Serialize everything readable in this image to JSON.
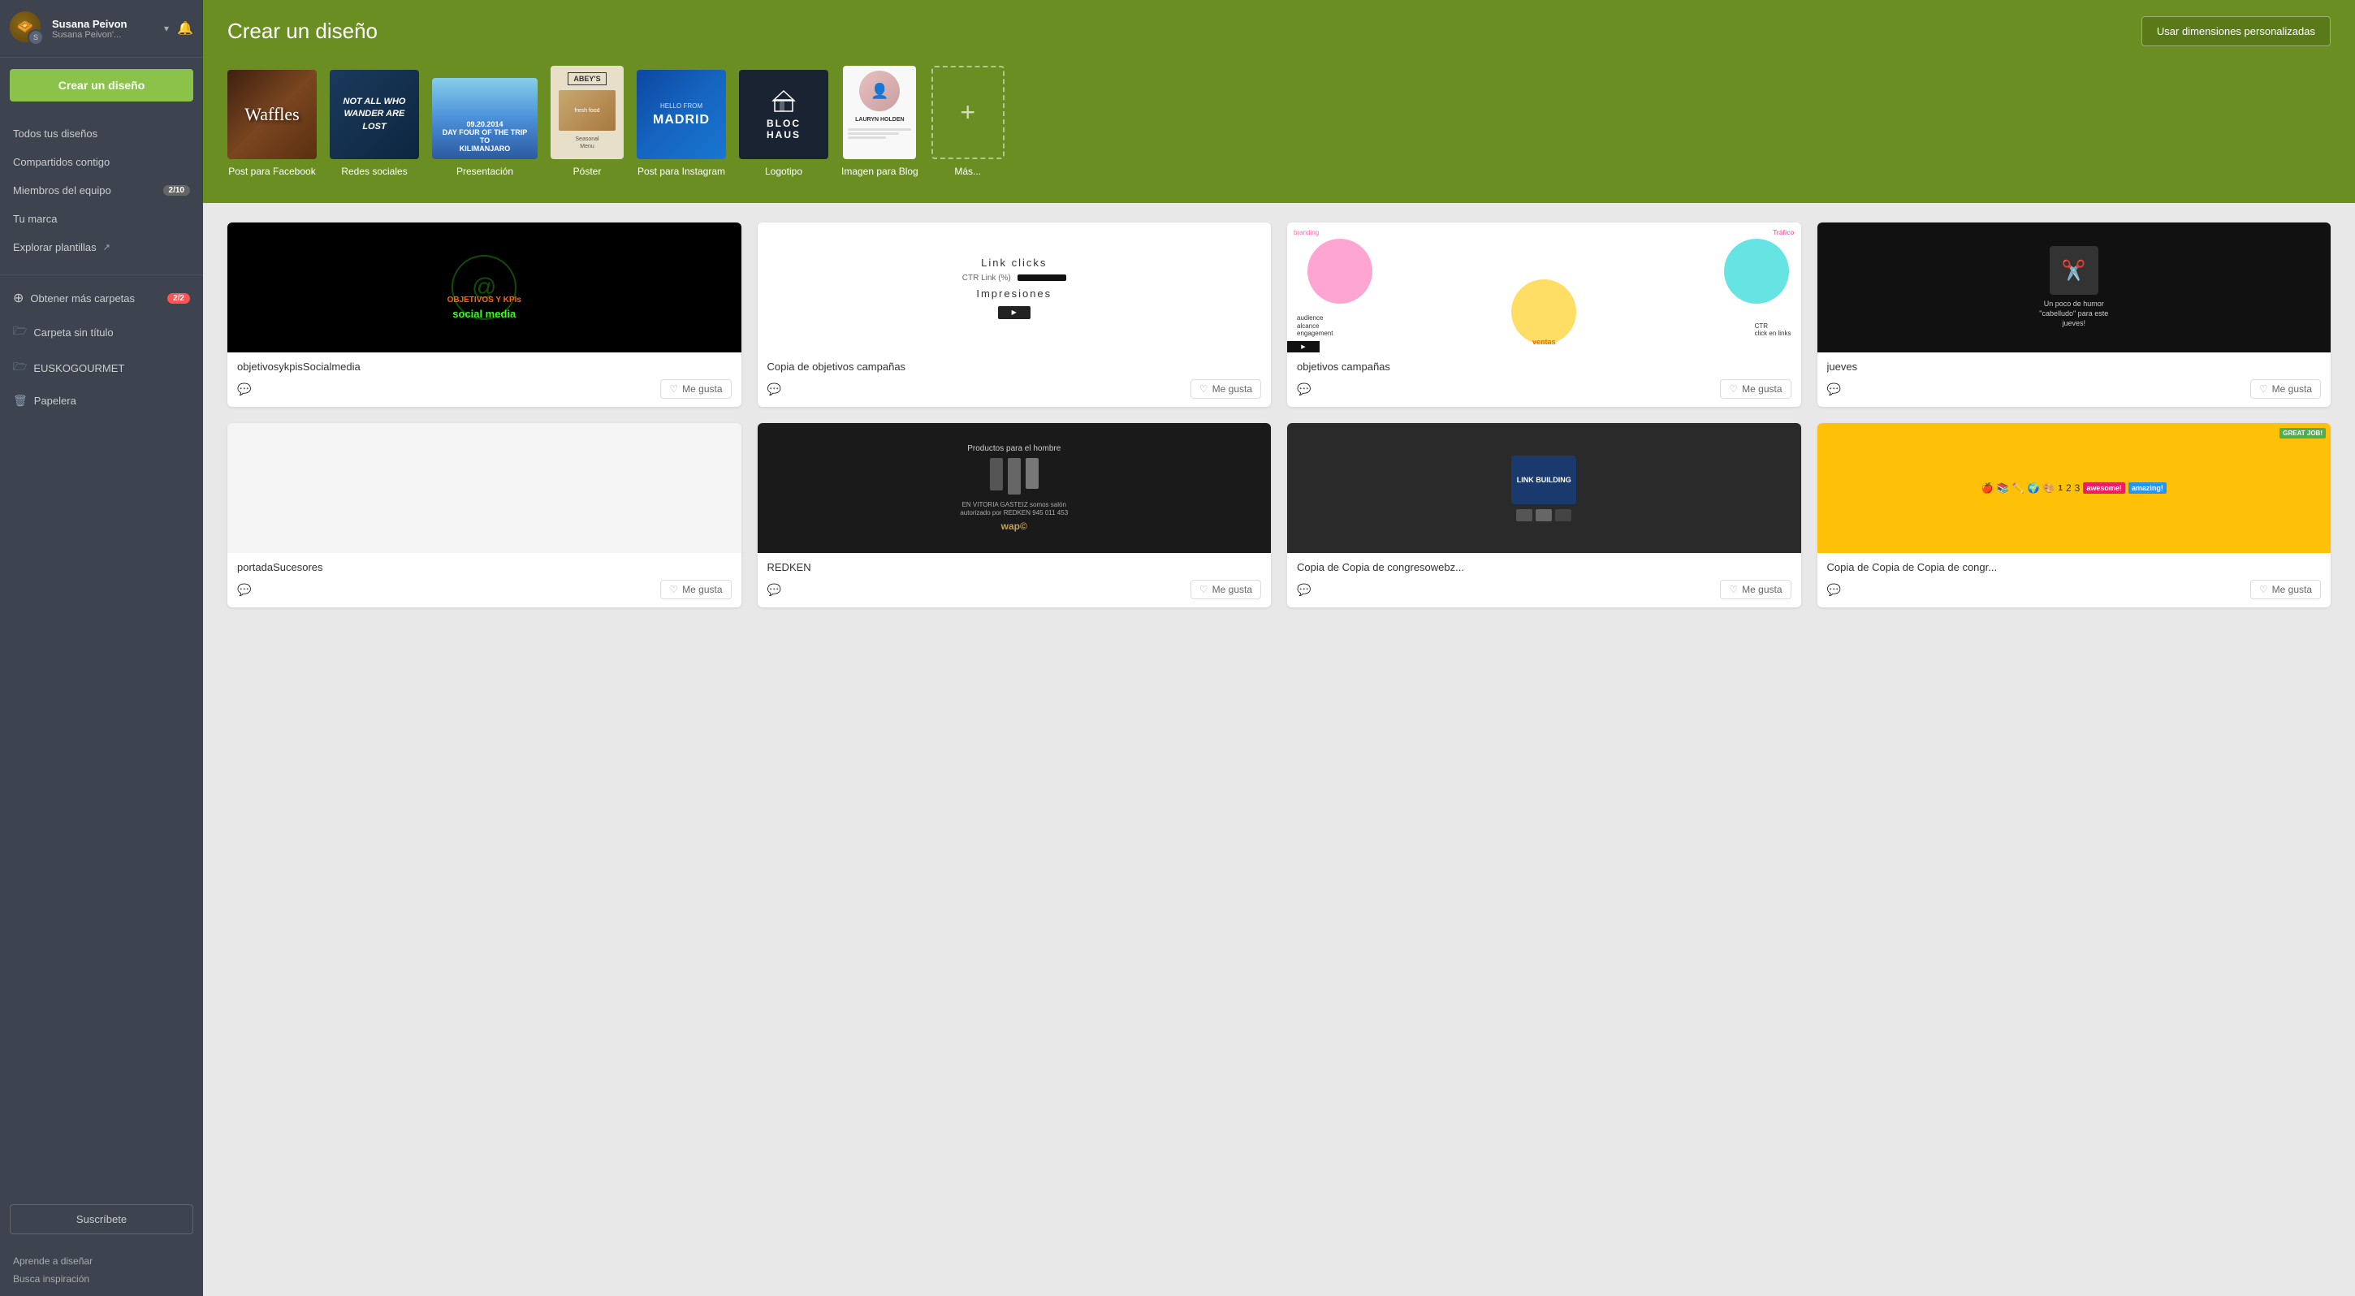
{
  "sidebar": {
    "user": {
      "name": "Susana Peivon",
      "sub": "Susana Peivon'...",
      "initials": "S"
    },
    "create_btn": "Crear un diseño",
    "nav_items": [
      {
        "id": "all-designs",
        "label": "Todos tus diseños",
        "icon": ""
      },
      {
        "id": "shared",
        "label": "Compartidos contigo",
        "icon": ""
      },
      {
        "id": "team",
        "label": "Miembros del equipo",
        "icon": "",
        "badge": "2/10"
      },
      {
        "id": "brand",
        "label": "Tu marca",
        "icon": ""
      },
      {
        "id": "explore",
        "label": "Explorar plantillas",
        "icon": "↗"
      }
    ],
    "folders_label": "Obtener más carpetas",
    "folders_badge": "2/2",
    "folders": [
      {
        "id": "untitled",
        "label": "Carpeta sin título",
        "icon": "folder"
      },
      {
        "id": "euskogourmet",
        "label": "EUSKOGOURMET",
        "icon": "folder"
      },
      {
        "id": "trash",
        "label": "Papelera",
        "icon": "trash"
      }
    ],
    "subscribe_btn": "Suscríbete",
    "footer_links": [
      {
        "label": "Aprende a diseñar"
      },
      {
        "label": "Busca inspiración"
      }
    ]
  },
  "topbar": {
    "title": "Crear un diseño",
    "custom_dimensions_btn": "Usar dimensiones personalizadas",
    "templates": [
      {
        "id": "facebook",
        "label": "Post para Facebook",
        "content": "Waffles"
      },
      {
        "id": "social",
        "label": "Redes sociales",
        "content": "NOT ALL WHO WANDER ARE LOST"
      },
      {
        "id": "presentation",
        "label": "Presentación",
        "content": "KILIMANJARO"
      },
      {
        "id": "poster",
        "label": "Póster",
        "content": "ABEY'S"
      },
      {
        "id": "instagram",
        "label": "Post para Instagram",
        "content": "HELLO FROM MADRID"
      },
      {
        "id": "logo",
        "label": "Logotipo",
        "content": "BLOC HAUS"
      },
      {
        "id": "blog",
        "label": "Imagen para Blog",
        "content": "LAURYN HOLDEN"
      },
      {
        "id": "more",
        "label": "Más...",
        "content": "+"
      }
    ]
  },
  "designs": {
    "cards": [
      {
        "id": "objetivos-kpis",
        "name": "objetivosykpisSocialmedia",
        "type": "social-media",
        "bg": "#000000"
      },
      {
        "id": "link-clicks",
        "name": "Copia de objetivos campañas",
        "type": "link-clicks",
        "bg": "#ffffff"
      },
      {
        "id": "objetivos-campanas",
        "name": "objetivos campañas",
        "type": "venn",
        "bg": "#ffffff"
      },
      {
        "id": "jueves",
        "name": "jueves",
        "type": "humor",
        "bg": "#111111"
      },
      {
        "id": "portada-sucesores",
        "name": "portadaSucesores",
        "type": "blank",
        "bg": "#f0f0f0"
      },
      {
        "id": "redken",
        "name": "REDKEN",
        "type": "product",
        "bg": "#222222"
      },
      {
        "id": "link-building",
        "name": "Copia de Copia de congresowebz...",
        "type": "link-building",
        "bg": "#333333"
      },
      {
        "id": "copia-congreso",
        "name": "Copia de Copia de Copia de congr...",
        "type": "school",
        "bg": "#ffd700"
      }
    ],
    "like_btn": "Me gusta"
  },
  "icons": {
    "heart": "♡",
    "comment": "💬",
    "bell": "🔔",
    "chevron_down": "▾",
    "folder": "🗁",
    "trash": "🗑",
    "plus_circle": "⊕",
    "arrow_up_right": "↗"
  }
}
